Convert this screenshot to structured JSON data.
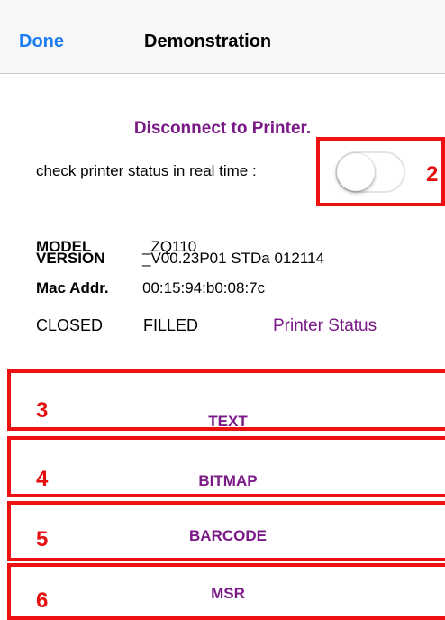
{
  "nav": {
    "done_label": "Done",
    "title": "Demonstration"
  },
  "connection": {
    "disconnect_label": "Disconnect to Printer.",
    "realtime_label": "check printer status in real time :",
    "realtime_enabled": false,
    "annotation": "2"
  },
  "info": {
    "model_label": "MODEL",
    "model_value": "_ZQ110",
    "version_label": "VERSION",
    "version_value": "_V00.23P01 STDa 012114",
    "mac_label": "Mac Addr.",
    "mac_value": "00:15:94:b0:08:7c"
  },
  "status": {
    "cover": "CLOSED",
    "paper": "FILLED",
    "printer_status_label": "Printer Status"
  },
  "commands": [
    {
      "label": "TEXT",
      "annotation": "3"
    },
    {
      "label": "BITMAP",
      "annotation": "4"
    },
    {
      "label": "BARCODE",
      "annotation": "5"
    },
    {
      "label": "MSR",
      "annotation": "6"
    }
  ],
  "colors": {
    "accent_blue": "#1d7df2",
    "accent_purple": "#7a1a87",
    "annotation_red": "#ee1111"
  }
}
